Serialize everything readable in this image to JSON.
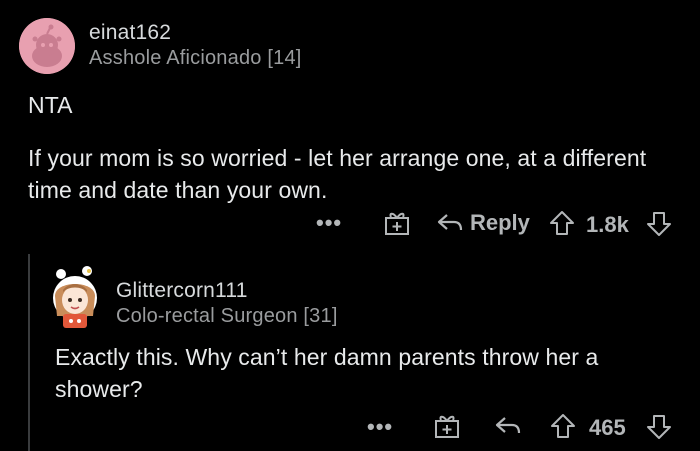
{
  "comments": [
    {
      "username": "einat162",
      "flair": "Asshole Aficionado [14]",
      "paragraphs": [
        "NTA",
        "If your mom is so worried - let her arrange one, at a different time and date than your own."
      ],
      "actions": {
        "more": "•••",
        "reply": "Reply",
        "score": "1.8k"
      },
      "avatar_color": "#e8a0b0"
    },
    {
      "username": "Glittercorn111",
      "flair": "Colo-rectal Surgeon [31]",
      "paragraphs": [
        "Exactly this. Why can’t her damn parents throw her a shower?"
      ],
      "actions": {
        "more": "•••",
        "score": "465"
      }
    }
  ],
  "colors": {
    "background": "#000000",
    "text": "#e8eaeb",
    "muted": "#9a9c9e",
    "icon": "#b3b6b8",
    "thread_line": "#3a3c3e"
  },
  "icons": [
    "award-icon",
    "reply-icon",
    "upvote-icon",
    "downvote-icon",
    "more-icon"
  ]
}
